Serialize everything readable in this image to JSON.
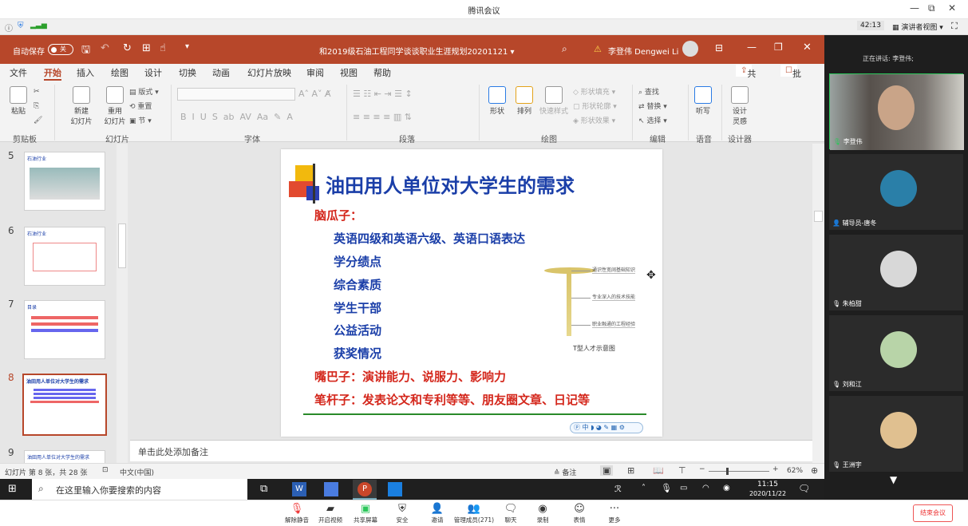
{
  "window": {
    "title": "腾讯会议",
    "controls": [
      "—",
      "⧉",
      "✕"
    ]
  },
  "top_toolbar": {
    "time": "42:13",
    "view_label": "演讲者视图"
  },
  "ppt": {
    "autosave_label": "自动保存",
    "autosave_state": "关",
    "doc_title": "和2019级石油工程同学谈谈职业生涯规划20201121",
    "user": "李登伟 Dengwei Li",
    "share": "共享",
    "comment": "批注",
    "tabs": [
      "文件",
      "开始",
      "插入",
      "绘图",
      "设计",
      "切换",
      "动画",
      "幻灯片放映",
      "审阅",
      "视图",
      "帮助"
    ],
    "active_tab": "开始",
    "groups": [
      "剪贴板",
      "幻灯片",
      "字体",
      "段落",
      "绘图",
      "编辑",
      "语音",
      "设计器"
    ],
    "buttons": {
      "paste": "粘贴",
      "new_slide": "新建\n幻灯片",
      "reuse": "重用\n幻灯片",
      "layout": "版式",
      "reset": "重置",
      "section": "节",
      "shape": "形状",
      "arrange": "排列",
      "quick_style": "快速样式",
      "fill": "形状填充",
      "outline": "形状轮廓",
      "effect": "形状效果",
      "find": "查找",
      "replace": "替换",
      "select": "选择",
      "dictate": "听写",
      "designer": "设计\n灵感"
    },
    "thumb_numbers": [
      "5",
      "6",
      "7",
      "8",
      "9"
    ],
    "thumb_titles": [
      "石油行业",
      "石油行业",
      "目录",
      "油田用人单位对大学生的需求",
      "油田用人单位对大学生的需求"
    ],
    "notes_placeholder": "单击此处添加备注",
    "status": {
      "slide_info": "幻灯片 第 8 张，共 28 张",
      "lang": "中文(中国)",
      "notes": "备注",
      "zoom": "62%"
    }
  },
  "slide": {
    "title": "油田用人单位对大学生的需求",
    "head_label": "脑瓜子：",
    "items": [
      "英语四级和英语六级、英语口语表达",
      "学分绩点",
      "综合素质",
      "学生干部",
      "公益活动",
      "获奖情况"
    ],
    "mouth_line": "嘴巴子：演讲能力、说服力、影响力",
    "pen_line": "笔杆子：发表论文和专利等等、朋友圈文章、日记等",
    "t_caption": "T型人才示意图",
    "t_labels": [
      "通识性宽阔基础知识",
      "专业深入的技术技能",
      "职业融通的工程经验"
    ],
    "colors": {
      "title": "#1a3ea8",
      "red": "#d4271c",
      "blue": "#1a3ea8",
      "green": "#2a8a2a"
    }
  },
  "meeting": {
    "speaker_label": "正在讲话: 李登伟;",
    "participants": [
      {
        "name": "李登伟"
      },
      {
        "name": "辅导员-唐冬"
      },
      {
        "name": "朱柏甜"
      },
      {
        "name": "刘和江"
      },
      {
        "name": "王洲宇"
      }
    ],
    "bottom": [
      "解除静音",
      "开启视频",
      "共享屏幕",
      "安全",
      "邀请",
      "管理成员(271)",
      "聊天",
      "录制",
      "表情",
      "更多"
    ],
    "end": "结束会议"
  },
  "taskbar": {
    "search_placeholder": "在这里输入你要搜索的内容",
    "time": "11:15",
    "date": "2020/11/22"
  }
}
